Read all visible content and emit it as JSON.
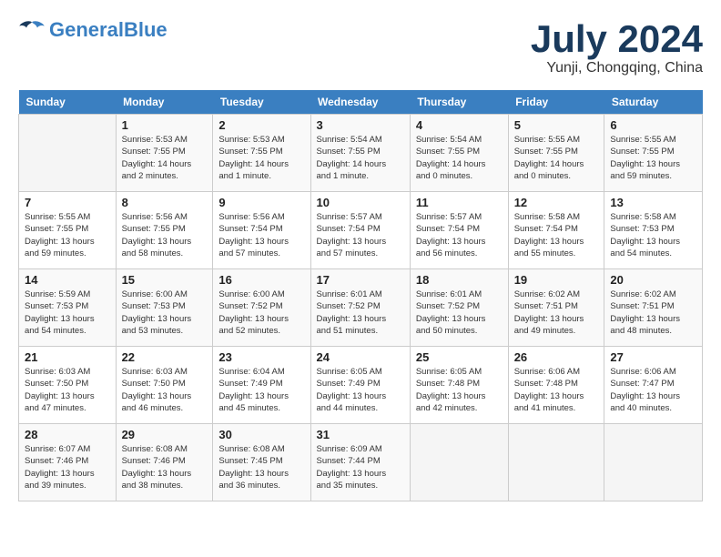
{
  "header": {
    "logo_general": "General",
    "logo_blue": "Blue",
    "month_title": "July 2024",
    "location": "Yunji, Chongqing, China"
  },
  "days_of_week": [
    "Sunday",
    "Monday",
    "Tuesday",
    "Wednesday",
    "Thursday",
    "Friday",
    "Saturday"
  ],
  "weeks": [
    [
      {
        "day": "",
        "info": ""
      },
      {
        "day": "1",
        "info": "Sunrise: 5:53 AM\nSunset: 7:55 PM\nDaylight: 14 hours\nand 2 minutes."
      },
      {
        "day": "2",
        "info": "Sunrise: 5:53 AM\nSunset: 7:55 PM\nDaylight: 14 hours\nand 1 minute."
      },
      {
        "day": "3",
        "info": "Sunrise: 5:54 AM\nSunset: 7:55 PM\nDaylight: 14 hours\nand 1 minute."
      },
      {
        "day": "4",
        "info": "Sunrise: 5:54 AM\nSunset: 7:55 PM\nDaylight: 14 hours\nand 0 minutes."
      },
      {
        "day": "5",
        "info": "Sunrise: 5:55 AM\nSunset: 7:55 PM\nDaylight: 14 hours\nand 0 minutes."
      },
      {
        "day": "6",
        "info": "Sunrise: 5:55 AM\nSunset: 7:55 PM\nDaylight: 13 hours\nand 59 minutes."
      }
    ],
    [
      {
        "day": "7",
        "info": "Sunrise: 5:55 AM\nSunset: 7:55 PM\nDaylight: 13 hours\nand 59 minutes."
      },
      {
        "day": "8",
        "info": "Sunrise: 5:56 AM\nSunset: 7:55 PM\nDaylight: 13 hours\nand 58 minutes."
      },
      {
        "day": "9",
        "info": "Sunrise: 5:56 AM\nSunset: 7:54 PM\nDaylight: 13 hours\nand 57 minutes."
      },
      {
        "day": "10",
        "info": "Sunrise: 5:57 AM\nSunset: 7:54 PM\nDaylight: 13 hours\nand 57 minutes."
      },
      {
        "day": "11",
        "info": "Sunrise: 5:57 AM\nSunset: 7:54 PM\nDaylight: 13 hours\nand 56 minutes."
      },
      {
        "day": "12",
        "info": "Sunrise: 5:58 AM\nSunset: 7:54 PM\nDaylight: 13 hours\nand 55 minutes."
      },
      {
        "day": "13",
        "info": "Sunrise: 5:58 AM\nSunset: 7:53 PM\nDaylight: 13 hours\nand 54 minutes."
      }
    ],
    [
      {
        "day": "14",
        "info": "Sunrise: 5:59 AM\nSunset: 7:53 PM\nDaylight: 13 hours\nand 54 minutes."
      },
      {
        "day": "15",
        "info": "Sunrise: 6:00 AM\nSunset: 7:53 PM\nDaylight: 13 hours\nand 53 minutes."
      },
      {
        "day": "16",
        "info": "Sunrise: 6:00 AM\nSunset: 7:52 PM\nDaylight: 13 hours\nand 52 minutes."
      },
      {
        "day": "17",
        "info": "Sunrise: 6:01 AM\nSunset: 7:52 PM\nDaylight: 13 hours\nand 51 minutes."
      },
      {
        "day": "18",
        "info": "Sunrise: 6:01 AM\nSunset: 7:52 PM\nDaylight: 13 hours\nand 50 minutes."
      },
      {
        "day": "19",
        "info": "Sunrise: 6:02 AM\nSunset: 7:51 PM\nDaylight: 13 hours\nand 49 minutes."
      },
      {
        "day": "20",
        "info": "Sunrise: 6:02 AM\nSunset: 7:51 PM\nDaylight: 13 hours\nand 48 minutes."
      }
    ],
    [
      {
        "day": "21",
        "info": "Sunrise: 6:03 AM\nSunset: 7:50 PM\nDaylight: 13 hours\nand 47 minutes."
      },
      {
        "day": "22",
        "info": "Sunrise: 6:03 AM\nSunset: 7:50 PM\nDaylight: 13 hours\nand 46 minutes."
      },
      {
        "day": "23",
        "info": "Sunrise: 6:04 AM\nSunset: 7:49 PM\nDaylight: 13 hours\nand 45 minutes."
      },
      {
        "day": "24",
        "info": "Sunrise: 6:05 AM\nSunset: 7:49 PM\nDaylight: 13 hours\nand 44 minutes."
      },
      {
        "day": "25",
        "info": "Sunrise: 6:05 AM\nSunset: 7:48 PM\nDaylight: 13 hours\nand 42 minutes."
      },
      {
        "day": "26",
        "info": "Sunrise: 6:06 AM\nSunset: 7:48 PM\nDaylight: 13 hours\nand 41 minutes."
      },
      {
        "day": "27",
        "info": "Sunrise: 6:06 AM\nSunset: 7:47 PM\nDaylight: 13 hours\nand 40 minutes."
      }
    ],
    [
      {
        "day": "28",
        "info": "Sunrise: 6:07 AM\nSunset: 7:46 PM\nDaylight: 13 hours\nand 39 minutes."
      },
      {
        "day": "29",
        "info": "Sunrise: 6:08 AM\nSunset: 7:46 PM\nDaylight: 13 hours\nand 38 minutes."
      },
      {
        "day": "30",
        "info": "Sunrise: 6:08 AM\nSunset: 7:45 PM\nDaylight: 13 hours\nand 36 minutes."
      },
      {
        "day": "31",
        "info": "Sunrise: 6:09 AM\nSunset: 7:44 PM\nDaylight: 13 hours\nand 35 minutes."
      },
      {
        "day": "",
        "info": ""
      },
      {
        "day": "",
        "info": ""
      },
      {
        "day": "",
        "info": ""
      }
    ]
  ]
}
